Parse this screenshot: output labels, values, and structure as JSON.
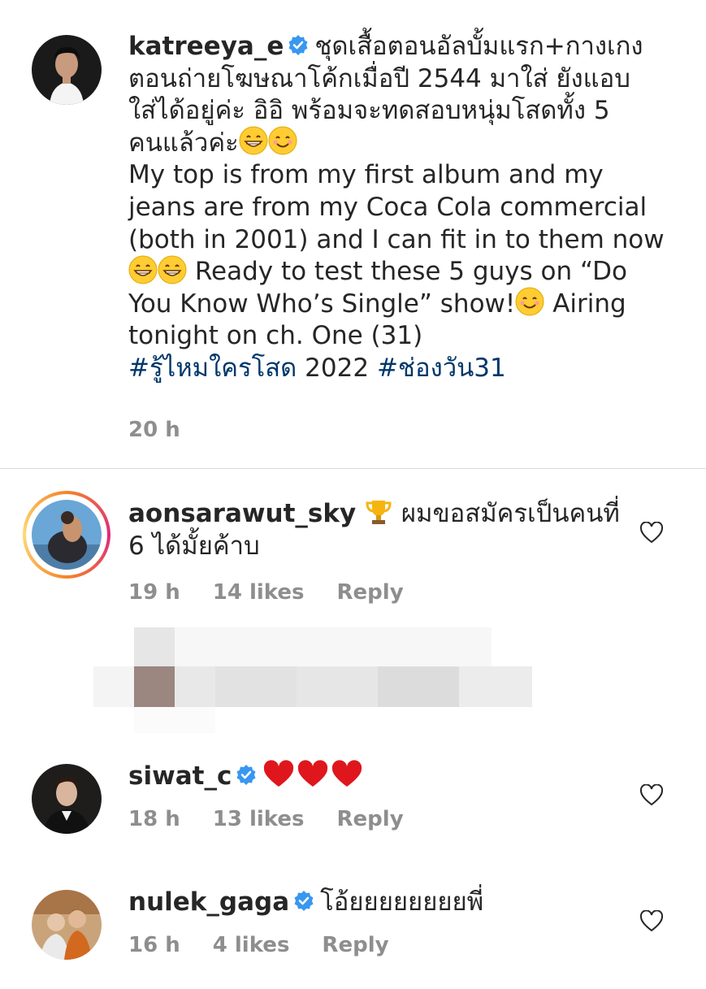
{
  "post": {
    "username": "katreeya_e",
    "caption_th_1": "ชุดเสื้อตอนอัลบั้มแรก+กางเกง",
    "caption_th_2": "ตอนถ่ายโฆษณาโค้กเมื่อปี 2544 มาใส่ ยังแอบ",
    "caption_th_3": "ใส่ได้อยู่ค่ะ อิอิ พร้อมจะทดสอบหนุ่มโสดทั้ง 5",
    "caption_th_4": "คนแล้วค่ะ",
    "caption_en_1": "My top is from my first album and my",
    "caption_en_2": "jeans are from my Coca Cola commercial",
    "caption_en_3": "(both in 2001) and I can fit in to them now",
    "caption_en_4": "Ready to test these 5 guys on “Do",
    "caption_en_5a": "You Know Who’s Single” show!",
    "caption_en_5b": "Airing",
    "caption_en_6": "tonight on ch. One (31)",
    "hashtag_1": "#รู้ไหมใครโสด",
    "hashtag_year": "2022",
    "hashtag_2": "#ช่องวัน31",
    "time": "20 h"
  },
  "comments": [
    {
      "username": "aonsarawut_sky",
      "text_1": "ผมขอสมัครเป็นคนที่",
      "text_2": "6 ได้มั้ยค้าบ",
      "time": "19 h",
      "likes": "14 likes",
      "reply": "Reply"
    },
    {
      "username": "siwat_c",
      "time": "18 h",
      "likes": "13 likes",
      "reply": "Reply"
    },
    {
      "username": "nulek_gaga",
      "text_1": "โอ้ยยยยยยยยพี่",
      "time": "16 h",
      "likes": "4 likes",
      "reply": "Reply"
    }
  ],
  "icons": {
    "verified": "verified-badge-icon",
    "heart": "heart-outline-icon",
    "trophy": "trophy-emoji",
    "grin": "grinning-emoji",
    "smile": "smiling-emoji",
    "red_heart": "red-heart-emoji"
  },
  "colors": {
    "verified": "#3897f0",
    "hashtag": "#00376b",
    "meta": "#8e8e8e",
    "text": "#262626",
    "red_heart": "#e0161d"
  }
}
